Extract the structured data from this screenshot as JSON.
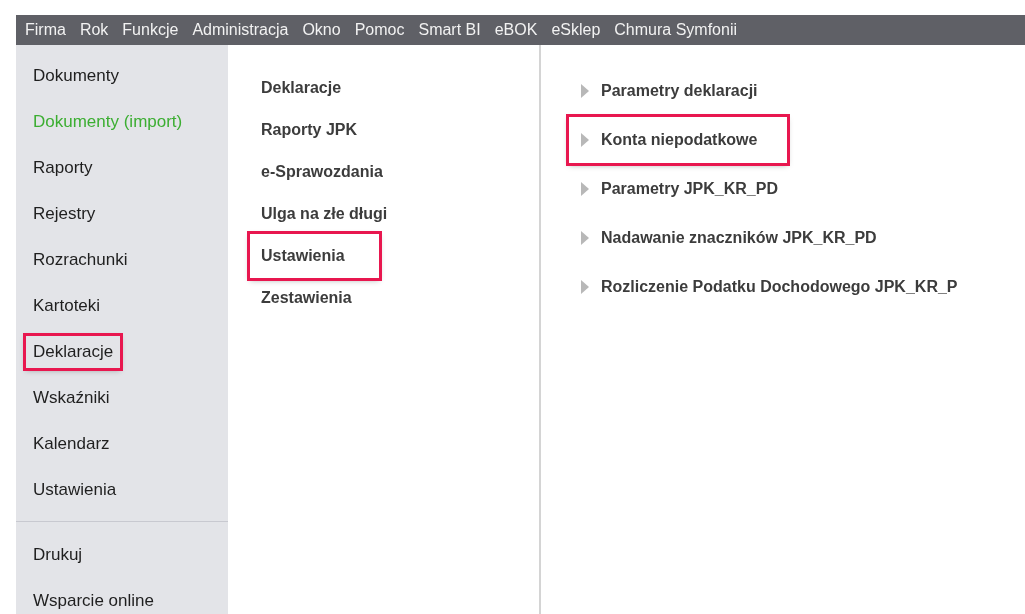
{
  "menu_bar": [
    "Firma",
    "Rok",
    "Funkcje",
    "Administracja",
    "Okno",
    "Pomoc",
    "Smart BI",
    "eBOK",
    "eSklep",
    "Chmura Symfonii"
  ],
  "sidebar": {
    "groups": [
      {
        "items": [
          {
            "label": "Dokumenty",
            "color": "#1f1f1f",
            "highlighted": false
          },
          {
            "label": "Dokumenty (import)",
            "color": "#3cae32",
            "highlighted": false
          },
          {
            "label": "Raporty",
            "color": "#1f1f1f",
            "highlighted": false
          },
          {
            "label": "Rejestry",
            "color": "#1f1f1f",
            "highlighted": false
          },
          {
            "label": "Rozrachunki",
            "color": "#1f1f1f",
            "highlighted": false
          },
          {
            "label": "Kartoteki",
            "color": "#1f1f1f",
            "highlighted": false
          },
          {
            "label": "Deklaracje",
            "color": "#1f1f1f",
            "highlighted": true
          },
          {
            "label": "Wskaźniki",
            "color": "#1f1f1f",
            "highlighted": false
          },
          {
            "label": "Kalendarz",
            "color": "#1f1f1f",
            "highlighted": false
          },
          {
            "label": "Ustawienia",
            "color": "#1f1f1f",
            "highlighted": false
          }
        ]
      },
      {
        "items": [
          {
            "label": "Drukuj",
            "color": "#1f1f1f",
            "highlighted": false
          },
          {
            "label": "Wsparcie online",
            "color": "#1f1f1f",
            "highlighted": false
          }
        ]
      }
    ]
  },
  "categories": [
    {
      "label": "Deklaracje",
      "highlighted": false
    },
    {
      "label": "Raporty JPK",
      "highlighted": false
    },
    {
      "label": "e-Sprawozdania",
      "highlighted": false
    },
    {
      "label": "Ulga na złe długi",
      "highlighted": false
    },
    {
      "label": "Ustawienia",
      "highlighted": true
    },
    {
      "label": "Zestawienia",
      "highlighted": false
    }
  ],
  "actions": [
    {
      "label": "Parametry deklaracji",
      "highlighted": false
    },
    {
      "label": "Konta niepodatkowe",
      "highlighted": true
    },
    {
      "label": "Parametry JPK_KR_PD",
      "highlighted": false
    },
    {
      "label": "Nadawanie znaczników JPK_KR_PD",
      "highlighted": false
    },
    {
      "label": "Rozliczenie Podatku Dochodowego JPK_KR_P",
      "highlighted": false
    }
  ]
}
